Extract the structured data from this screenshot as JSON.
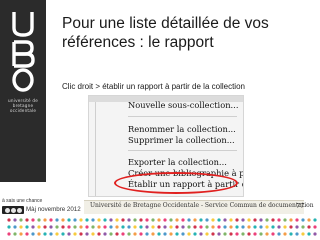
{
  "slide": {
    "title": "Pour une liste détaillée de vos références : le rapport",
    "instruction": "Clic droit > établir un rapport à partir de la collection"
  },
  "logo": {
    "letters": [
      "U",
      "B",
      "O"
    ],
    "subtext": "université de bretagne occidentale"
  },
  "context_menu": {
    "items": [
      "Nouvelle sous-collection...",
      "Renommer la collection...",
      "Supprimer la collection...",
      "Exporter la collection...",
      "Créer une bibliographie à partir de la collection...",
      "Établir un rapport à partir de la collection..."
    ],
    "highlighted_item": "Établir un rapport à partir de la collection..."
  },
  "footer": {
    "license_prefix": "à sais une chance",
    "date": "Màj novembre 2012",
    "institution": "Université de Bretagne Occidentale - Service Commun de documentation",
    "page_number": "77"
  },
  "colors": {
    "sidebar": "#2b2b2b",
    "highlight": "#e0201f",
    "dot_palette": [
      "#c8102e",
      "#f28c28",
      "#f6c21c",
      "#6aa84f",
      "#2e86c1",
      "#7d3c98",
      "#e91e63",
      "#00a6a6"
    ]
  }
}
